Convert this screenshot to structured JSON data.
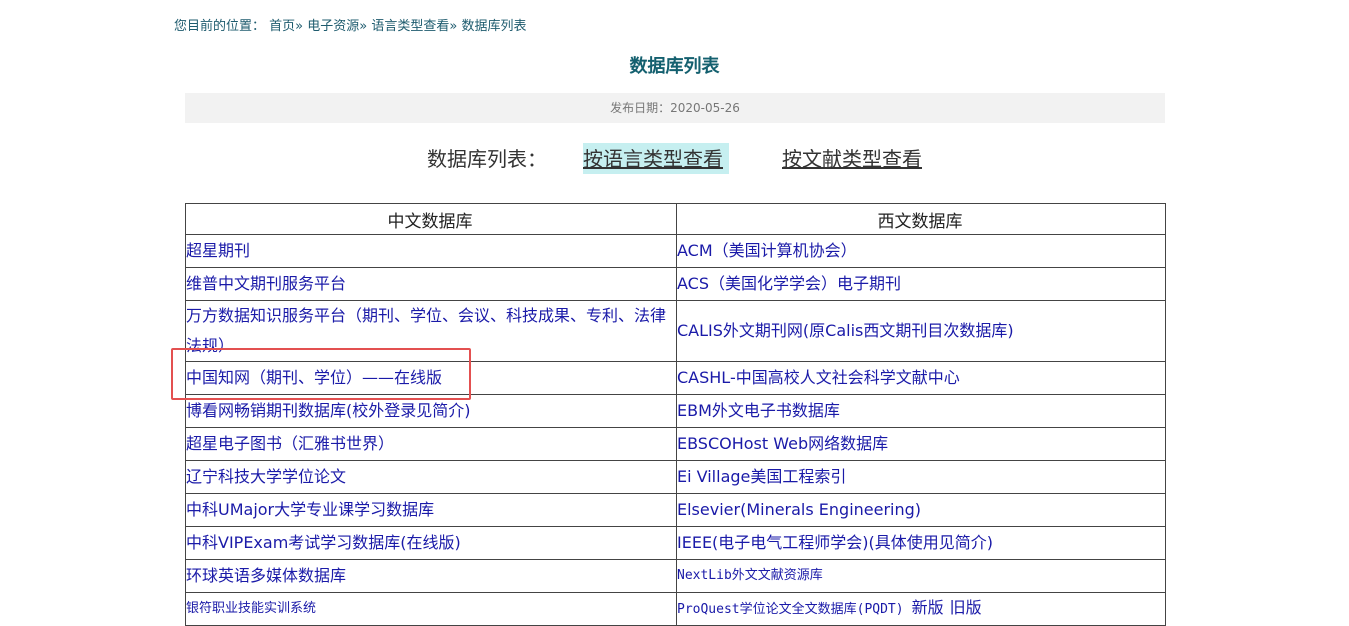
{
  "breadcrumb": {
    "prefix": "您目前的位置：",
    "items": [
      "首页",
      "电子资源",
      "语言类型查看",
      "数据库列表"
    ],
    "separator": "»"
  },
  "page_title": "数据库列表",
  "publish": "发布日期：2020-05-26",
  "selector": {
    "label": "数据库列表：",
    "by_language": "按语言类型查看",
    "by_doc_type": "按文献类型查看"
  },
  "table": {
    "headers": [
      "中文数据库",
      "西文数据库"
    ],
    "rows": [
      [
        "超星期刊",
        "ACM（美国计算机协会）"
      ],
      [
        "维普中文期刊服务平台",
        "ACS（美国化学学会）电子期刊"
      ],
      [
        "万方数据知识服务平台（期刊、学位、会议、科技成果、专利、法律法规）",
        "CALIS外文期刊网(原Calis西文期刊目次数据库)"
      ],
      [
        "中国知网（期刊、学位）——在线版",
        "CASHL-中国高校人文社会科学文献中心"
      ],
      [
        "博看网畅销期刊数据库(校外登录见简介)",
        "EBM外文电子书数据库"
      ],
      [
        "超星电子图书（汇雅书世界）",
        "EBSCOHost Web网络数据库"
      ],
      [
        "辽宁科技大学学位论文",
        "Ei Village美国工程索引"
      ],
      [
        "中科UMajor大学专业课学习数据库",
        "Elsevier(Minerals Engineering)"
      ],
      [
        "中科VIPExam考试学习数据库(在线版)",
        "IEEE(电子电气工程师学会)(具体使用见简介)"
      ],
      [
        "环球英语多媒体数据库",
        "NextLib外文文献资源库"
      ],
      [
        "银符职业技能实训系统",
        "ProQuest学位论文全文数据库(PQDT)"
      ]
    ],
    "last_row_extra": [
      "新版",
      "旧版"
    ]
  }
}
